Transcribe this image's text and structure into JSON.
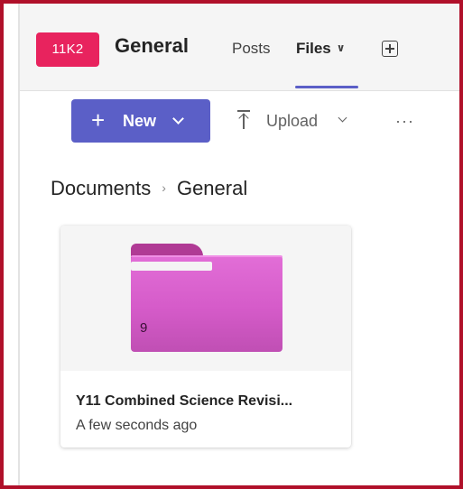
{
  "header": {
    "team_avatar": "11K2",
    "channel_title": "General",
    "tabs": [
      {
        "label": "Posts"
      },
      {
        "label": "Files"
      }
    ]
  },
  "toolbar": {
    "new_label": "New",
    "upload_label": "Upload",
    "more_label": "···"
  },
  "breadcrumb": {
    "root": "Documents",
    "current": "General"
  },
  "files": [
    {
      "name": "Y11 Combined Science Revisi...",
      "modified": "A few seconds ago",
      "item_count": "9",
      "icon": "folder-icon"
    }
  ],
  "colors": {
    "accent": "#5b5fc7",
    "team_avatar": "#e8235e",
    "folder": "#d55bc9",
    "frame": "#b0102a"
  }
}
